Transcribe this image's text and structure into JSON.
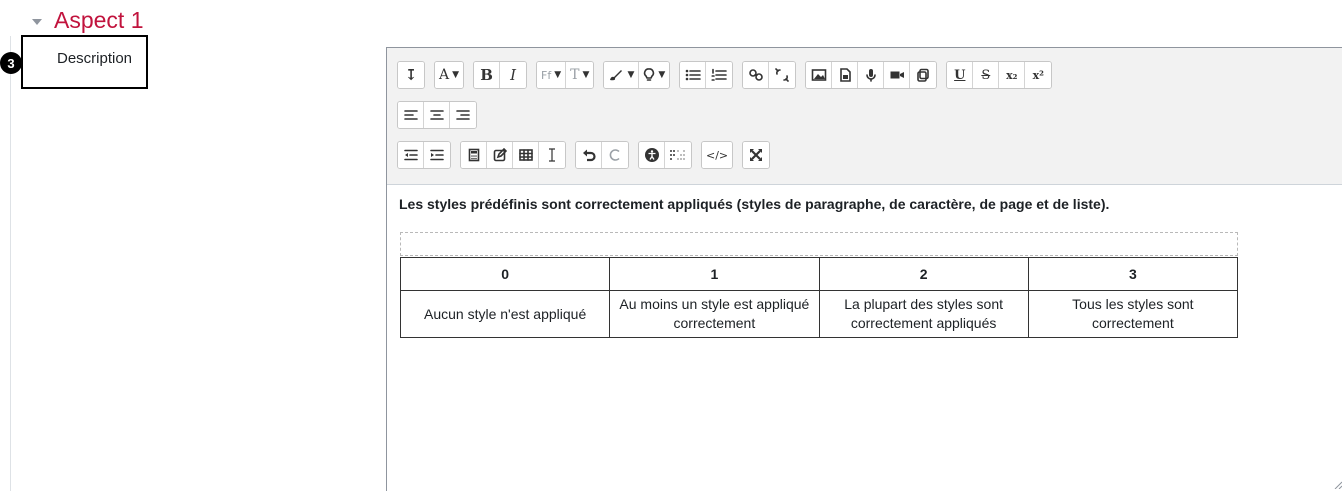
{
  "section": {
    "title": "Aspect 1",
    "step_number": "3",
    "description_label": "Description"
  },
  "toolbar": {
    "row1_groups": [
      [
        {
          "name": "show-more-buttons",
          "icon": "show-more-icon",
          "text": "↧"
        }
      ],
      [
        {
          "name": "font-color",
          "icon": "font-color-icon",
          "text": "A",
          "caret": true
        }
      ],
      [
        {
          "name": "bold",
          "icon": "bold-icon",
          "text": "B"
        },
        {
          "name": "italic",
          "icon": "italic-icon",
          "text": "I"
        }
      ],
      [
        {
          "name": "font-family",
          "icon": "font-family-icon",
          "text": "Ff",
          "caret": true
        },
        {
          "name": "font-size",
          "icon": "font-size-icon",
          "text": "T",
          "caret": true
        }
      ],
      [
        {
          "name": "highlight",
          "icon": "brush-icon",
          "text": "",
          "caret": true
        },
        {
          "name": "styles",
          "icon": "lightbulb-icon",
          "text": "",
          "caret": true
        }
      ],
      [
        {
          "name": "unordered-list",
          "icon": "bullet-list-icon",
          "text": ""
        },
        {
          "name": "ordered-list",
          "icon": "numbered-list-icon",
          "text": ""
        }
      ],
      [
        {
          "name": "link",
          "icon": "link-icon",
          "text": ""
        },
        {
          "name": "unlink",
          "icon": "unlink-icon",
          "text": ""
        }
      ],
      [
        {
          "name": "image",
          "icon": "image-icon",
          "text": ""
        },
        {
          "name": "media",
          "icon": "media-file-icon",
          "text": ""
        },
        {
          "name": "record-audio",
          "icon": "microphone-icon",
          "text": ""
        },
        {
          "name": "record-video",
          "icon": "video-camera-icon",
          "text": ""
        },
        {
          "name": "manage-files",
          "icon": "files-icon",
          "text": ""
        }
      ],
      [
        {
          "name": "underline",
          "icon": "underline-icon",
          "text": "U"
        },
        {
          "name": "strikethrough",
          "icon": "strikethrough-icon",
          "text": "S"
        },
        {
          "name": "subscript",
          "icon": "subscript-icon",
          "text": "x₂"
        },
        {
          "name": "superscript",
          "icon": "superscript-icon",
          "text": "x²"
        }
      ]
    ],
    "row2_groups": [
      [
        {
          "name": "align-left",
          "icon": "align-left-icon",
          "text": ""
        },
        {
          "name": "align-center",
          "icon": "align-center-icon",
          "text": ""
        },
        {
          "name": "align-right",
          "icon": "align-right-icon",
          "text": ""
        }
      ]
    ],
    "row3_groups": [
      [
        {
          "name": "outdent",
          "icon": "outdent-icon",
          "text": ""
        },
        {
          "name": "indent",
          "icon": "indent-icon",
          "text": ""
        }
      ],
      [
        {
          "name": "equation",
          "icon": "calculator-icon",
          "text": ""
        },
        {
          "name": "edit-html",
          "icon": "edit-icon",
          "text": ""
        },
        {
          "name": "table",
          "icon": "table-icon",
          "text": ""
        },
        {
          "name": "special-character",
          "icon": "text-cursor-icon",
          "text": ""
        }
      ],
      [
        {
          "name": "undo",
          "icon": "undo-icon",
          "text": ""
        },
        {
          "name": "redo",
          "icon": "redo-icon",
          "text": ""
        }
      ],
      [
        {
          "name": "accessibility-checker",
          "icon": "accessibility-icon",
          "text": ""
        },
        {
          "name": "screenreader-helper",
          "icon": "braille-icon",
          "text": ""
        }
      ],
      [
        {
          "name": "html-source",
          "icon": "code-icon",
          "text": "</>"
        }
      ],
      [
        {
          "name": "fullscreen",
          "icon": "fullscreen-icon",
          "text": ""
        }
      ]
    ]
  },
  "content": {
    "paragraph": "Les styles prédéfinis sont correctement appliqués (styles de paragraphe, de caractère, de page et de liste).",
    "table": {
      "headers": [
        "0",
        "1",
        "2",
        "3"
      ],
      "row": [
        "Aucun style n'est appliqué",
        "Au moins un style est appliqué correctement",
        "La plupart des styles sont correctement appliqués",
        "Tous les styles sont correctement"
      ]
    }
  },
  "colors": {
    "section_title": "#c1133d",
    "toolbar_bg": "#f2f2f2"
  }
}
